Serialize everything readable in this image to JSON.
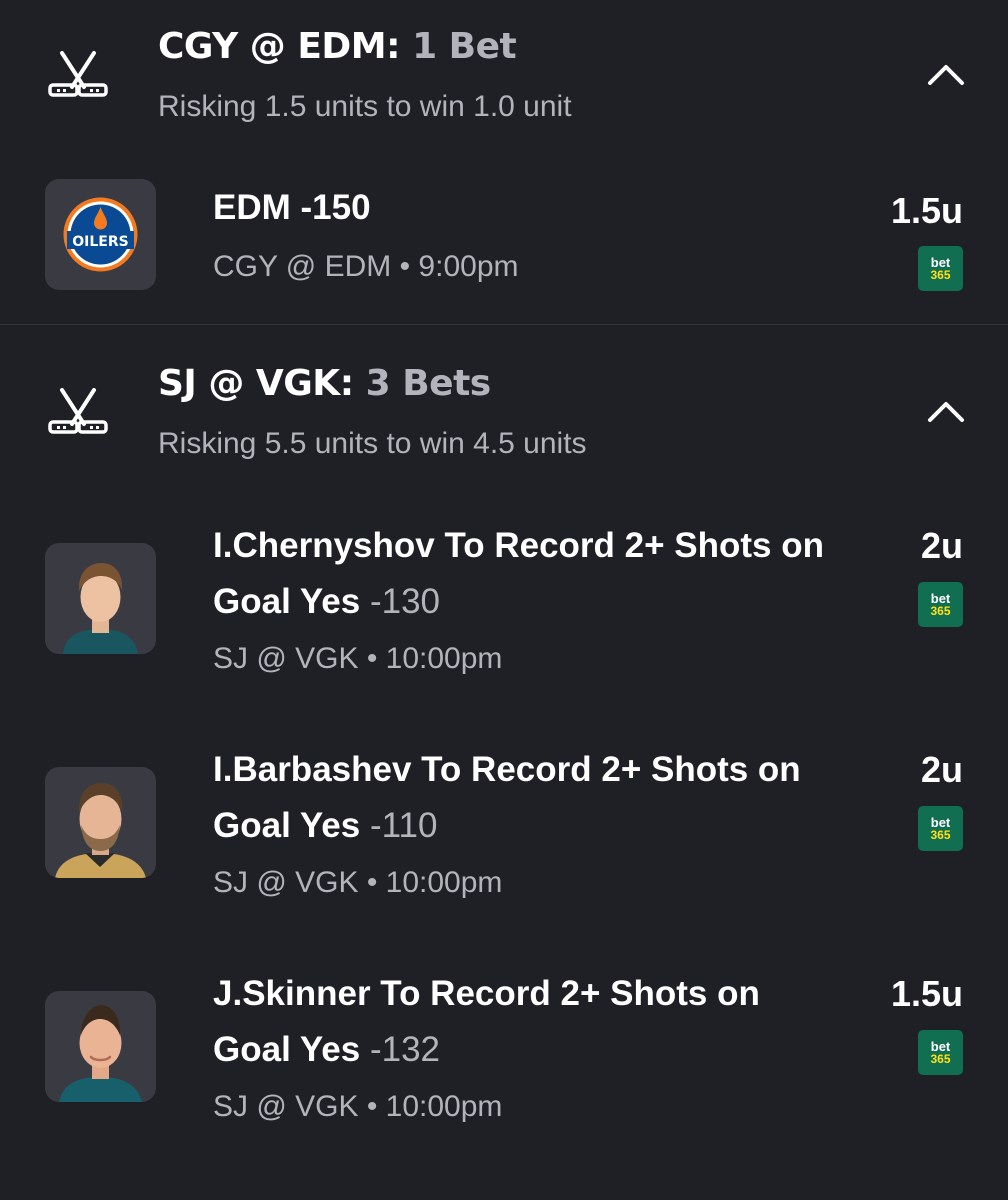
{
  "colors": {
    "background": "#1f2026",
    "muted_text": "#b3b4bb",
    "tile": "#3a3b42",
    "bet365_green": "#126e51",
    "bet365_yellow": "#ffe115"
  },
  "groups": [
    {
      "sport_icon": "hockey-sticks-icon",
      "title": "CGY @ EDM:",
      "count": "1 Bet",
      "subtitle": "Risking 1.5 units to win 1.0 unit",
      "chevron_icon": "chevron-up-icon",
      "bets": [
        {
          "thumb_icon": "oilers-logo",
          "logo_text": "OILERS",
          "title": "EDM -150",
          "odds": "",
          "meta": "CGY @ EDM • 9:00pm",
          "units": "1.5u",
          "book_line1": "bet",
          "book_line2": "365"
        }
      ]
    },
    {
      "sport_icon": "hockey-sticks-icon",
      "title": "SJ @ VGK:",
      "count": "3 Bets",
      "subtitle": "Risking 5.5 units to win 4.5 units",
      "chevron_icon": "chevron-up-icon",
      "bets": [
        {
          "thumb_icon": "player-headshot",
          "title": "I.Chernyshov To Record 2+ Shots on Goal Yes",
          "odds": "-130",
          "meta": "SJ @ VGK • 10:00pm",
          "units": "2u",
          "book_line1": "bet",
          "book_line2": "365"
        },
        {
          "thumb_icon": "player-headshot",
          "title": "I.Barbashev To Record 2+ Shots on Goal Yes",
          "odds": "-110",
          "meta": "SJ @ VGK • 10:00pm",
          "units": "2u",
          "book_line1": "bet",
          "book_line2": "365"
        },
        {
          "thumb_icon": "player-headshot",
          "title": "J.Skinner To Record 2+ Shots on Goal Yes",
          "odds": "-132",
          "meta": "SJ @ VGK • 10:00pm",
          "units": "1.5u",
          "book_line1": "bet",
          "book_line2": "365"
        }
      ]
    }
  ]
}
